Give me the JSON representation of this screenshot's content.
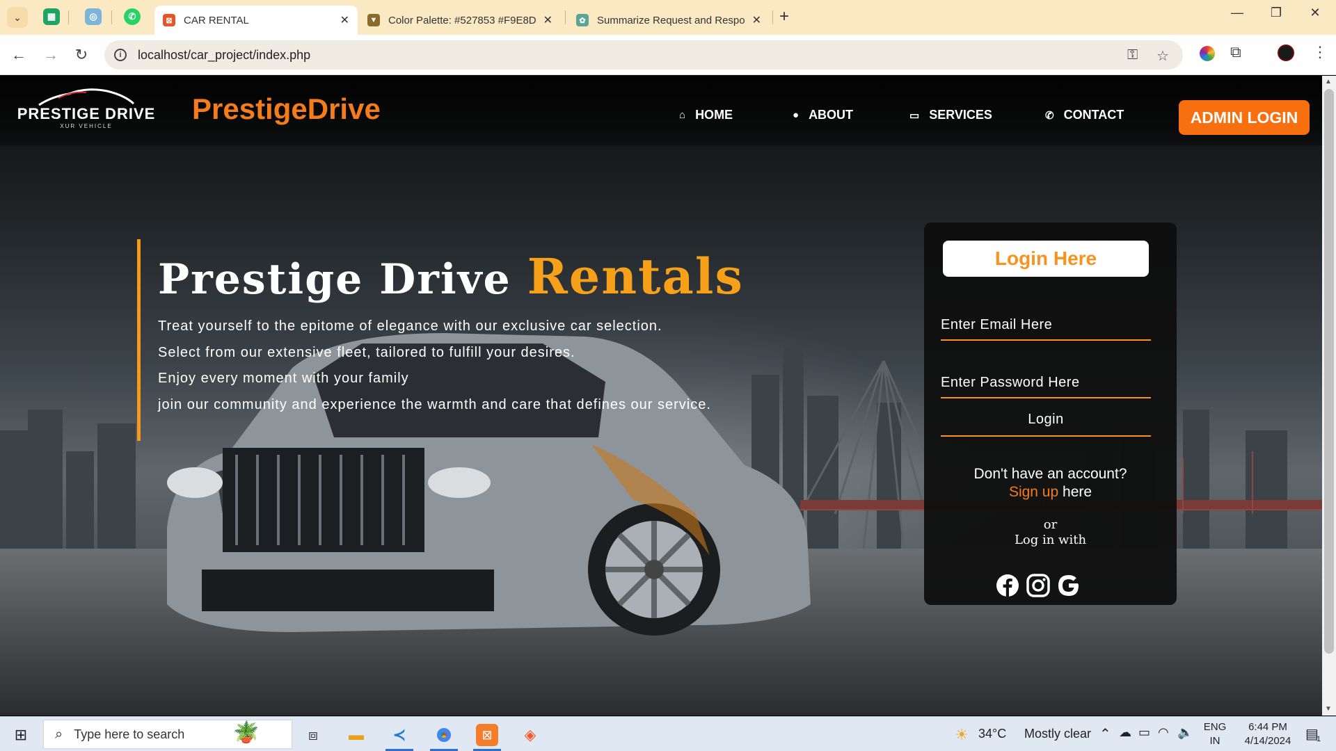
{
  "browser": {
    "tabs": [
      {
        "title": "CAR RENTAL",
        "active": true,
        "favicon_color": "#e8542a"
      },
      {
        "title": "Color Palette: #527853 #F9E8D",
        "active": false,
        "favicon_color": "#8a6b2a"
      },
      {
        "title": "Summarize Request and Respor",
        "active": false,
        "favicon_color": "#5aa596"
      }
    ],
    "url": "localhost/car_project/index.php"
  },
  "site": {
    "logo_text": "PRESTIGE DRIVE",
    "logo_sub": "XUR VEHICLE",
    "brand": "PrestigeDrive",
    "nav": [
      {
        "label": "HOME",
        "icon": "home-icon"
      },
      {
        "label": "ABOUT",
        "icon": "info-icon"
      },
      {
        "label": "SERVICES",
        "icon": "car-icon"
      },
      {
        "label": "CONTACT",
        "icon": "phone-icon"
      }
    ],
    "admin_button": "ADMIN LOGIN",
    "colors": {
      "brand": "#f47c1b",
      "accent": "#f7a11a",
      "admin_bg": "#f86f0f"
    }
  },
  "hero": {
    "title_main": "Prestige Drive",
    "title_accent": "Rentals",
    "lines": [
      "Treat yourself to the epitome of elegance with our exclusive car selection.",
      "Select from our extensive fleet, tailored to fulfill your desires.",
      "Enjoy every moment with your family",
      "join our community and experience the warmth and care that defines our service."
    ]
  },
  "login": {
    "title": "Login Here",
    "email_placeholder": "Enter Email Here",
    "password_placeholder": "Enter Password Here",
    "submit_label": "Login",
    "no_account": "Don't have an account?",
    "signup_link": "Sign up",
    "signup_suffix": "here",
    "or": "or",
    "log_in_with": "Log in with",
    "socials": [
      "facebook-icon",
      "instagram-icon",
      "google-icon"
    ]
  },
  "taskbar": {
    "search_placeholder": "Type here to search",
    "weather_temp": "34°C",
    "weather_text": "Mostly clear",
    "lang_line1": "ENG",
    "lang_line2": "IN",
    "time": "6:44 PM",
    "date": "4/14/2024",
    "notification_count": "1"
  }
}
